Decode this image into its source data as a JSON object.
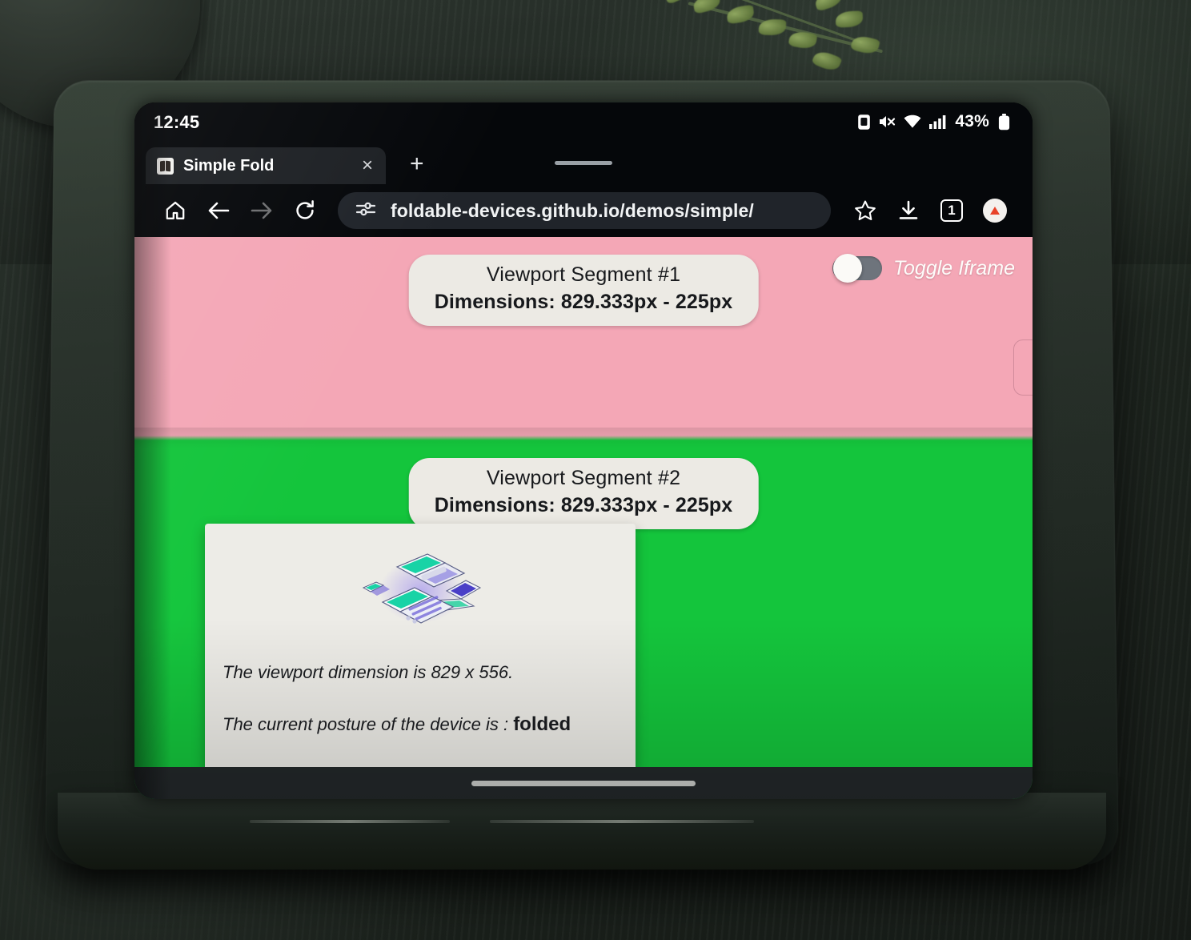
{
  "device": {
    "kind": "foldable-phone",
    "case_color": "#2c352e"
  },
  "status_bar": {
    "clock": "12:45",
    "battery_percent": "43%",
    "icons": [
      "screenshot-icon",
      "mute-icon",
      "wifi-icon",
      "cellular-signal-icon",
      "battery-icon"
    ]
  },
  "browser": {
    "tab": {
      "title": "Simple Fold",
      "favicon": "foldable-devices-favicon",
      "close_label": "×"
    },
    "new_tab_label": "+",
    "toolbar": {
      "home_icon": "home-icon",
      "back_icon": "back-arrow-icon",
      "forward_icon": "forward-arrow-icon",
      "reload_icon": "reload-icon",
      "site_settings_icon": "tune-icon",
      "url": "foldable-devices.github.io/demos/simple/",
      "bookmark_icon": "star-icon",
      "download_icon": "download-icon",
      "tab_count": "1",
      "menu_icon": "profile-update-icon"
    }
  },
  "page": {
    "segment1": {
      "label": "Viewport Segment #1",
      "dimensions": "Dimensions: 829.333px - 225px",
      "background_color": "#f4a7b6"
    },
    "segment2": {
      "label": "Viewport Segment #2",
      "dimensions": "Dimensions: 829.333px - 225px",
      "background_color": "#14c53c"
    },
    "toggle": {
      "label": "Toggle Iframe",
      "state": "off"
    },
    "card": {
      "illustration": "foldable-devices-illustration",
      "viewport_line": "The viewport dimension is 829 x 556.",
      "posture_prefix": "The current posture of the device is : ",
      "posture_value": "folded"
    }
  },
  "system_nav": {
    "gesture_bar": "home-gesture-pill"
  }
}
